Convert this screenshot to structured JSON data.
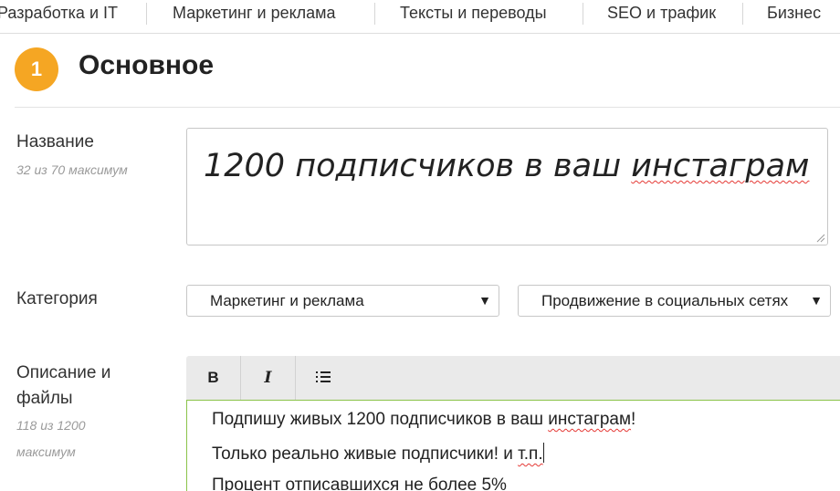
{
  "topnav": {
    "items": [
      {
        "label": "Разработка и IT"
      },
      {
        "label": "Маркетинг и реклама"
      },
      {
        "label": "Тексты и переводы"
      },
      {
        "label": "SEO и трафик"
      },
      {
        "label": "Бизнес"
      }
    ]
  },
  "section": {
    "number": "1",
    "title": "Основное"
  },
  "name_field": {
    "label": "Название",
    "hint": "32 из 70 максимум",
    "value_plain": "1200 подписчиков в ваш ",
    "value_misspelled": "инстаграм"
  },
  "category_field": {
    "label": "Категория",
    "select_main": "Маркетинг и реклама",
    "select_sub": "Продвижение в социальных сетях"
  },
  "description_field": {
    "label_line1": "Описание и",
    "label_line2": "файлы",
    "hint_line1": "118 из 1200",
    "hint_line2": "максимум",
    "toolbar": {
      "bold_label": "B",
      "italic_label": "I",
      "list_icon": "bulleted-list-icon"
    },
    "lines": [
      {
        "plain": "Подпишу живых 1200 подписчиков в ваш ",
        "misspelled": "инстаграм",
        "after": "!"
      },
      {
        "plain": "Только реально живые подписчики! и ",
        "misspelled": "т.п.",
        "after": ""
      },
      {
        "plain": "Процент отписавшихся не более 5%",
        "misspelled": "",
        "after": ""
      }
    ]
  },
  "colors": {
    "accent": "#f5a623",
    "editor_focus": "#8bc34a",
    "spellcheck": "#e53935"
  }
}
